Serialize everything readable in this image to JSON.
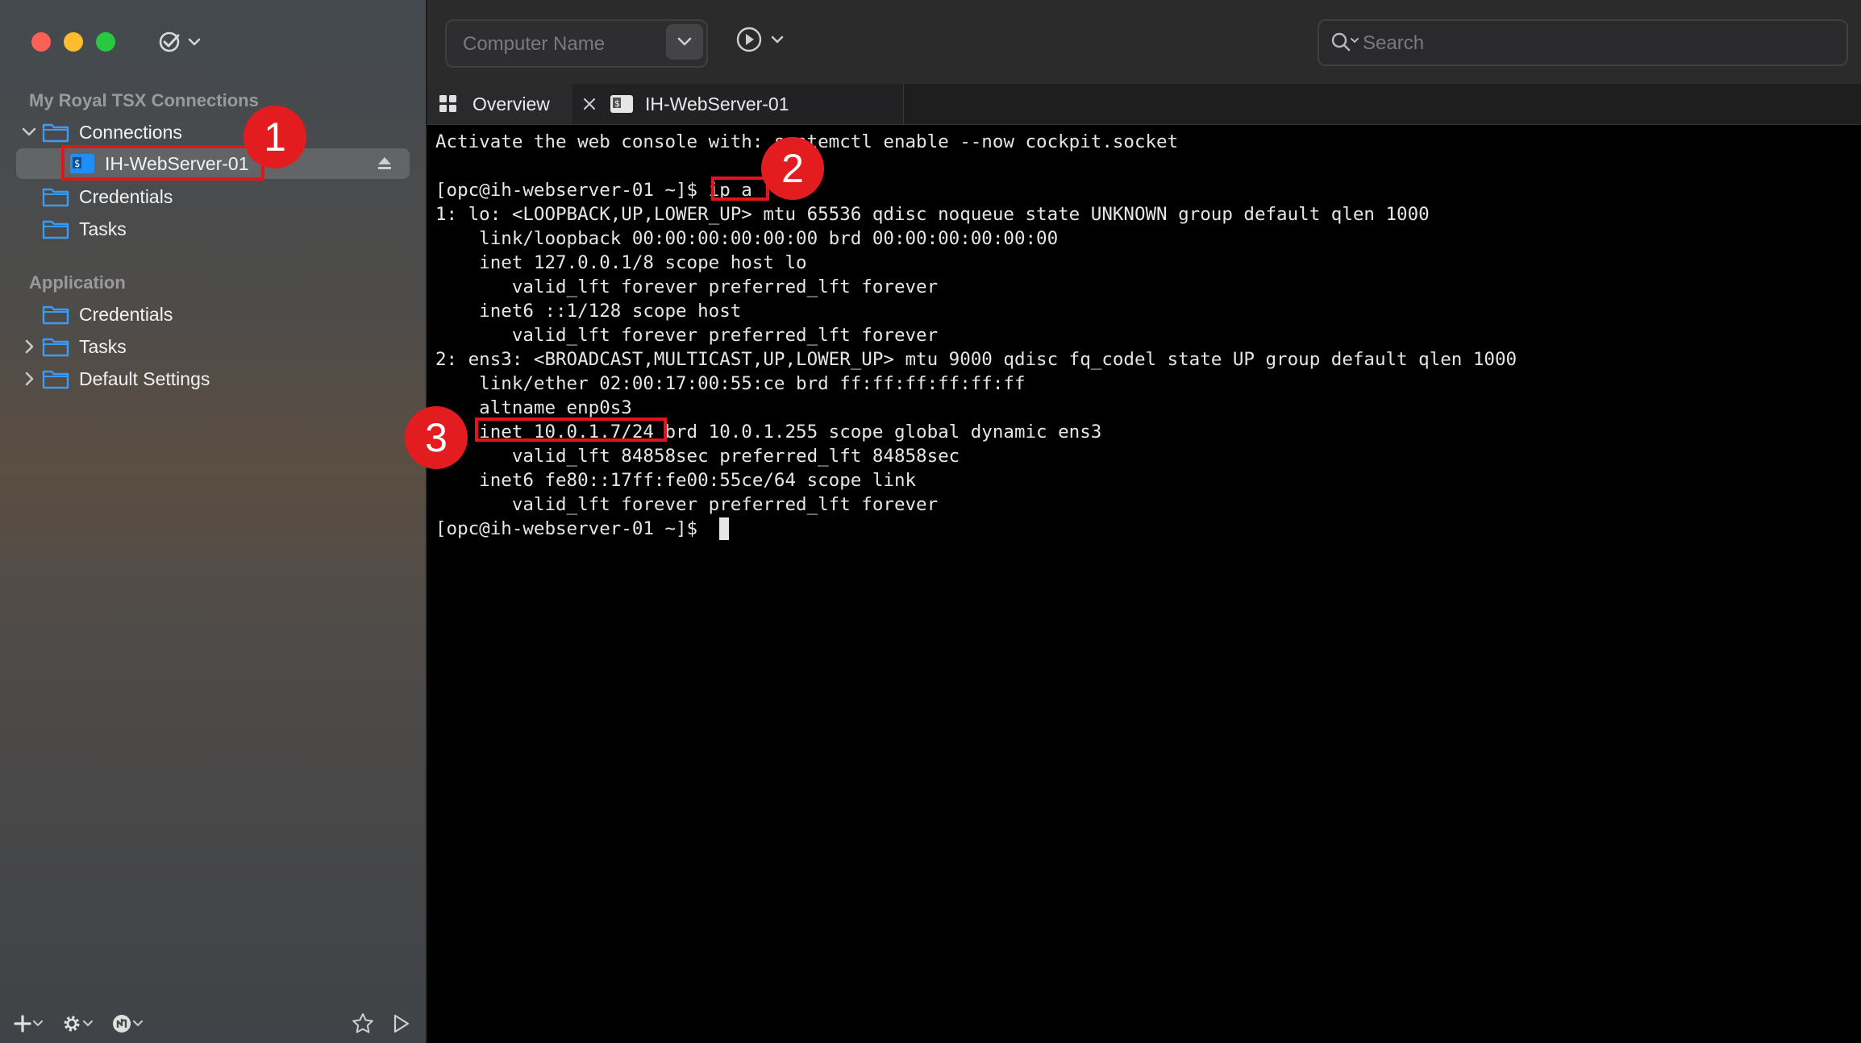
{
  "sidebar": {
    "section_connections_title": "My Royal TSX Connections",
    "connections_label": "Connections",
    "server_label": "IH-WebServer-01",
    "credentials_label": "Credentials",
    "tasks_label": "Tasks",
    "section_application_title": "Application",
    "app_credentials_label": "Credentials",
    "app_tasks_label": "Tasks",
    "app_default_settings_label": "Default Settings"
  },
  "toolbar": {
    "computer_name_placeholder": "Computer Name",
    "search_placeholder": "Search"
  },
  "tabs": {
    "overview_label": "Overview",
    "ih_label": "IH-WebServer-01"
  },
  "terminal": {
    "lines": [
      "Activate the web console with: systemctl enable --now cockpit.socket",
      "",
      "[opc@ih-webserver-01 ~]$ ip a",
      "1: lo: <LOOPBACK,UP,LOWER_UP> mtu 65536 qdisc noqueue state UNKNOWN group default qlen 1000",
      "    link/loopback 00:00:00:00:00:00 brd 00:00:00:00:00:00",
      "    inet 127.0.0.1/8 scope host lo",
      "       valid_lft forever preferred_lft forever",
      "    inet6 ::1/128 scope host",
      "       valid_lft forever preferred_lft forever",
      "2: ens3: <BROADCAST,MULTICAST,UP,LOWER_UP> mtu 9000 qdisc fq_codel state UP group default qlen 1000",
      "    link/ether 02:00:17:00:55:ce brd ff:ff:ff:ff:ff:ff",
      "    altname enp0s3",
      "    inet 10.0.1.7/24 brd 10.0.1.255 scope global dynamic ens3",
      "       valid_lft 84858sec preferred_lft 84858sec",
      "    inet6 fe80::17ff:fe00:55ce/64 scope link",
      "       valid_lft forever preferred_lft forever",
      "[opc@ih-webserver-01 ~]$ "
    ]
  },
  "annotations": {
    "badge1": "1",
    "badge2": "2",
    "badge3": "3"
  },
  "colors": {
    "annotation_red": "#e4141c",
    "folder_blue": "#3b9cf7"
  }
}
